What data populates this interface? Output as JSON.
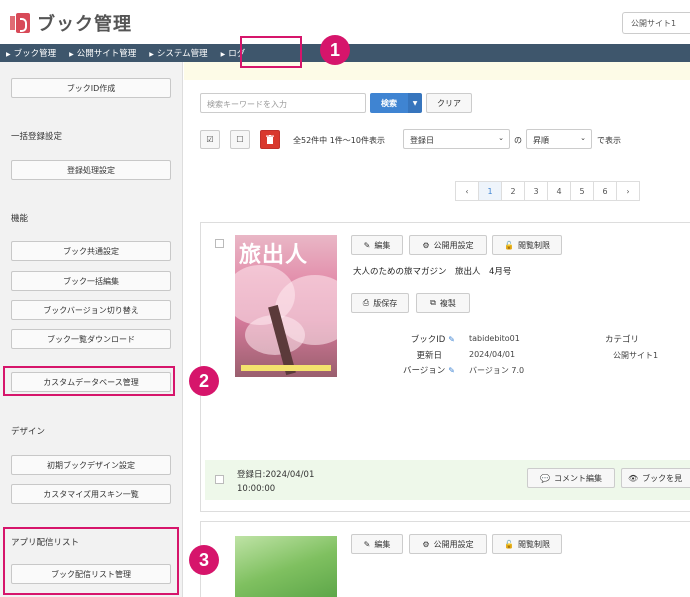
{
  "header": {
    "app_title": "ブック管理",
    "site_select": "公開サイト1"
  },
  "breadcrumb": [
    "ブック管理",
    "公開サイト管理",
    "システム管理",
    "ログ"
  ],
  "callouts": [
    "1",
    "2",
    "3"
  ],
  "sidebar": {
    "create_book": "ブックID作成",
    "batch_section": "一括登録設定",
    "register_process": "登録処理設定",
    "function_section": "機能",
    "function_items": [
      "ブック共通設定",
      "ブック一括編集",
      "ブックバージョン切り替え",
      "ブック一覧ダウンロード",
      "カスタムデータベース管理"
    ],
    "design_section": "デザイン",
    "design_items": [
      "初期ブックデザイン設定",
      "カスタマイズ用スキン一覧"
    ],
    "app_section": "アプリ配信リスト",
    "app_items": [
      "ブック配信リスト管理"
    ]
  },
  "toolbar": {
    "search_placeholder": "検索キーワードを入力",
    "search_button": "検索",
    "clear_button": "クリア",
    "check_all": "☑",
    "uncheck_all": "☐",
    "delete_icon": "trash-icon",
    "count_text": "全52件中 1件〜10件表示",
    "sort_field": "登録日",
    "no_text": "の",
    "sort_order": "昇順",
    "display_text": "で表示"
  },
  "pagination": {
    "prev": "‹",
    "pages": [
      "1",
      "2",
      "3",
      "4",
      "5",
      "6"
    ],
    "next": "›",
    "current": "1"
  },
  "book": {
    "cover_title": "旅出人",
    "edit": "編集",
    "publish_settings": "公開用設定",
    "access_limit": "閲覧制限",
    "title": "大人のための旅マガジン　旅出人　4月号",
    "save_version": "版保存",
    "duplicate": "複製",
    "book_id_label": "ブックID",
    "book_id": "tabidebito01",
    "updated_label": "更新日",
    "updated": "2024/04/01",
    "version_label": "バージョン",
    "version": "バージョン 7.0",
    "category_label": "カテゴリ",
    "category": "公開サイト1",
    "registered": "登録日:2024/04/01",
    "registered_time": "10:00:00",
    "comment_edit": "コメント編集",
    "view_book": "ブックを見"
  },
  "book2": {
    "edit": "編集",
    "publish_settings": "公開用設定",
    "access_limit": "閲覧制限"
  },
  "colors": {
    "nav_bg": "#3e566c",
    "accent": "#d6156b",
    "primary": "#3f84d2",
    "danger": "#d9382d"
  }
}
